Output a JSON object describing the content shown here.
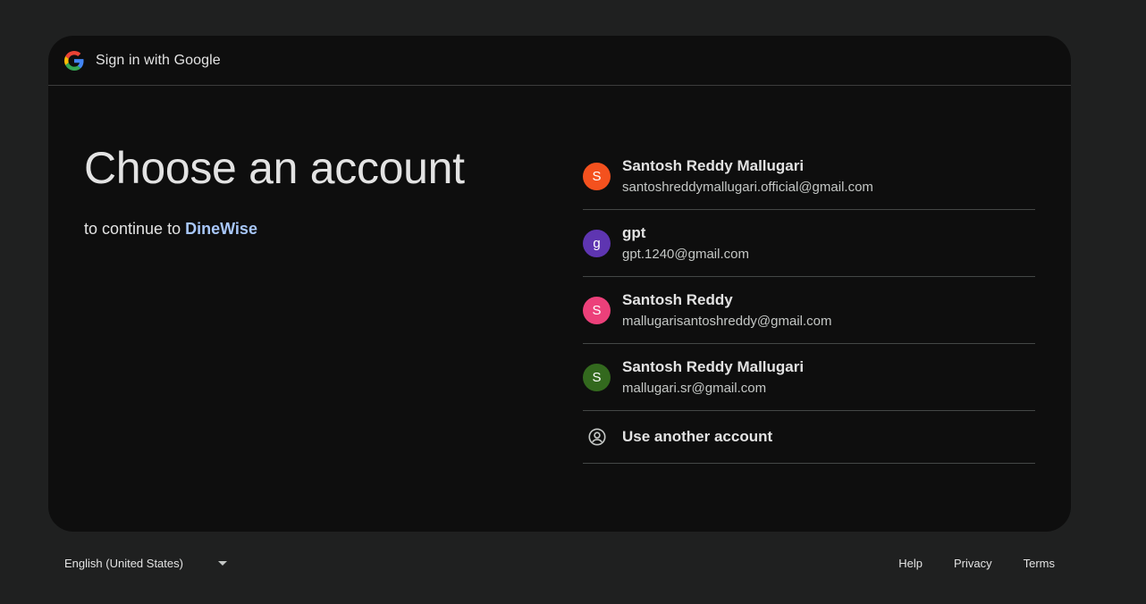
{
  "header": {
    "title": "Sign in with Google",
    "logo_icon": "google-g-logo"
  },
  "main": {
    "headline": "Choose an account",
    "continue_prefix": "to continue to ",
    "app_name": "DineWise"
  },
  "accounts": [
    {
      "initial": "S",
      "name": "Santosh Reddy Mallugari",
      "email": "santoshreddymallugari.official@gmail.com",
      "color": "#f4511e"
    },
    {
      "initial": "g",
      "name": "gpt",
      "email": "gpt.1240@gmail.com",
      "color": "#5e35b1"
    },
    {
      "initial": "S",
      "name": "Santosh Reddy",
      "email": "mallugarisantoshreddy@gmail.com",
      "color": "#ec407a"
    },
    {
      "initial": "S",
      "name": "Santosh Reddy Mallugari",
      "email": "mallugari.sr@gmail.com",
      "color": "#33691e"
    }
  ],
  "use_another": {
    "label": "Use another account",
    "icon": "account-circle-icon"
  },
  "footer": {
    "language": "English (United States)",
    "help": "Help",
    "privacy": "Privacy",
    "terms": "Terms"
  },
  "colors": {
    "page_bg": "#1f2020",
    "card_bg": "#0e0e0e",
    "accent": "#a8c7fa"
  }
}
